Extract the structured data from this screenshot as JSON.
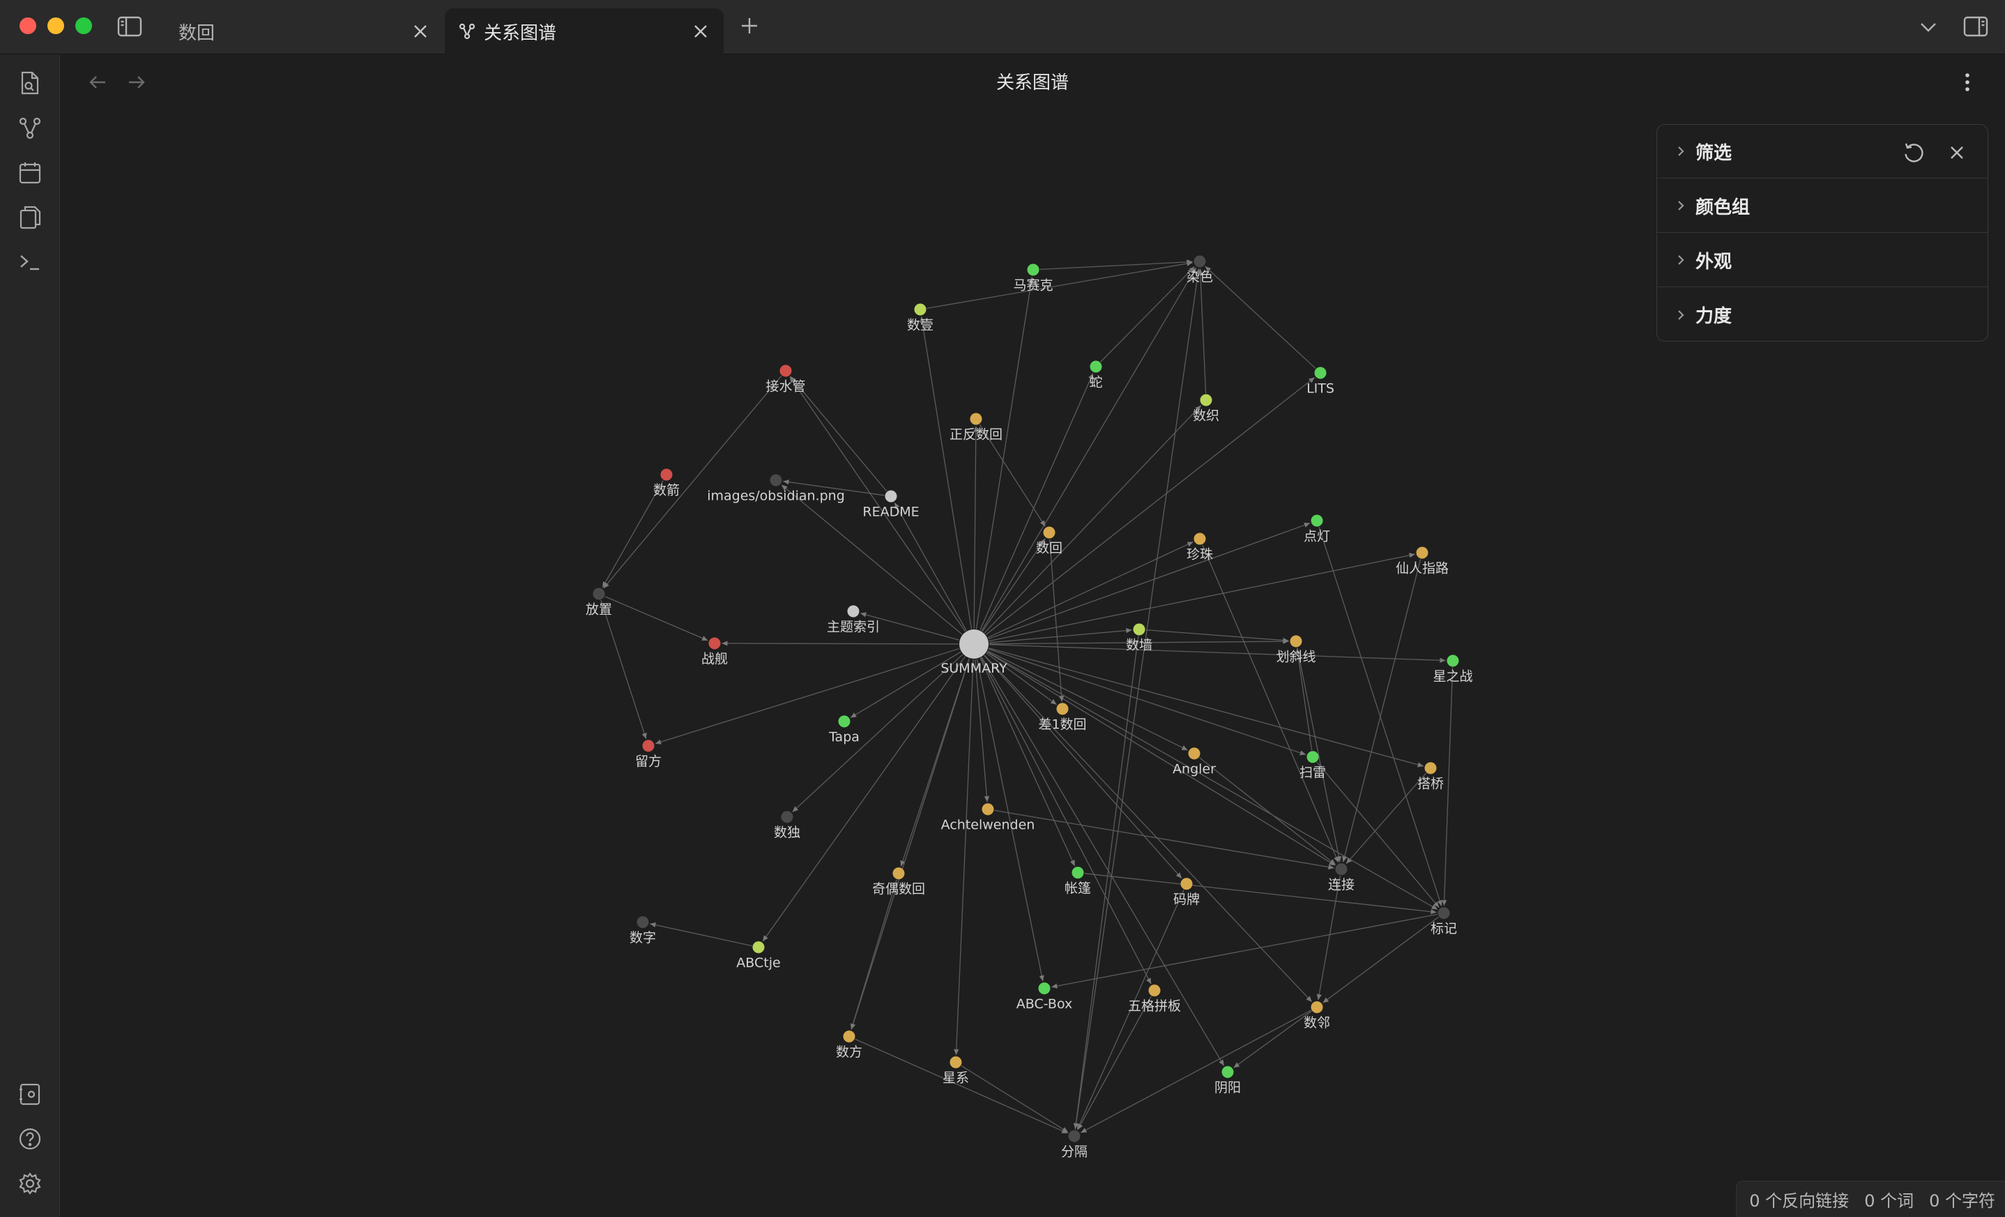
{
  "window": {
    "tabs": [
      {
        "label": "数回",
        "active": false
      },
      {
        "label": "关系图谱",
        "active": true
      }
    ]
  },
  "view": {
    "title": "关系图谱"
  },
  "ribbon": {
    "icons": [
      "file-search-icon",
      "graph-icon",
      "calendar-icon",
      "copy-icon",
      "terminal-icon",
      "vault-icon",
      "help-icon",
      "settings-icon"
    ]
  },
  "graph_controls": {
    "sections": [
      {
        "label": "筛选"
      },
      {
        "label": "颜色组"
      },
      {
        "label": "外观"
      },
      {
        "label": "力度"
      }
    ]
  },
  "statusbar": {
    "backlinks": "0 个反向链接",
    "words": "0 个词",
    "chars": "0 个字符"
  },
  "colors": {
    "green": "#5ad35a",
    "lime": "#b8d65a",
    "orange": "#d7a94e",
    "red": "#d0504a",
    "gray": "#4a4a4a",
    "white": "#c8c8c8",
    "edge": "#5c5c5c"
  },
  "graph": {
    "nodes": [
      {
        "id": "SUMMARY",
        "label": "SUMMARY",
        "color": "white",
        "hub": true
      },
      {
        "id": "染色",
        "label": "染色",
        "color": "gray"
      },
      {
        "id": "马赛克",
        "label": "马赛克",
        "color": "green"
      },
      {
        "id": "数壹",
        "label": "数壹",
        "color": "lime"
      },
      {
        "id": "蛇",
        "label": "蛇",
        "color": "green"
      },
      {
        "id": "LITS",
        "label": "LITS",
        "color": "green"
      },
      {
        "id": "数织",
        "label": "数织",
        "color": "lime"
      },
      {
        "id": "接水管",
        "label": "接水管",
        "color": "red"
      },
      {
        "id": "正反数回",
        "label": "正反数回",
        "color": "orange"
      },
      {
        "id": "数箭",
        "label": "数箭",
        "color": "red"
      },
      {
        "id": "images",
        "label": "images/obsidian.png",
        "color": "gray"
      },
      {
        "id": "README",
        "label": "README",
        "color": "white"
      },
      {
        "id": "数回",
        "label": "数回",
        "color": "orange"
      },
      {
        "id": "珍珠",
        "label": "珍珠",
        "color": "orange"
      },
      {
        "id": "点灯",
        "label": "点灯",
        "color": "green"
      },
      {
        "id": "仙人指路",
        "label": "仙人指路",
        "color": "orange"
      },
      {
        "id": "放置",
        "label": "放置",
        "color": "gray"
      },
      {
        "id": "主题索引",
        "label": "主题索引",
        "color": "white"
      },
      {
        "id": "战舰",
        "label": "战舰",
        "color": "red"
      },
      {
        "id": "数墙",
        "label": "数墙",
        "color": "lime"
      },
      {
        "id": "划斜线",
        "label": "划斜线",
        "color": "orange"
      },
      {
        "id": "星之战",
        "label": "星之战",
        "color": "green"
      },
      {
        "id": "差1数回",
        "label": "差1数回",
        "color": "orange"
      },
      {
        "id": "Tapa",
        "label": "Tapa",
        "color": "green"
      },
      {
        "id": "留方",
        "label": "留方",
        "color": "red"
      },
      {
        "id": "Angler",
        "label": "Angler",
        "color": "orange"
      },
      {
        "id": "扫雷",
        "label": "扫雷",
        "color": "green"
      },
      {
        "id": "搭桥",
        "label": "搭桥",
        "color": "orange"
      },
      {
        "id": "数独",
        "label": "数独",
        "color": "gray"
      },
      {
        "id": "Achtelwenden",
        "label": "Achtelwenden",
        "color": "orange"
      },
      {
        "id": "奇偶数回",
        "label": "奇偶数回",
        "color": "orange"
      },
      {
        "id": "帐篷",
        "label": "帐篷",
        "color": "green"
      },
      {
        "id": "码牌",
        "label": "码牌",
        "color": "orange"
      },
      {
        "id": "连接",
        "label": "连接",
        "color": "gray"
      },
      {
        "id": "标记",
        "label": "标记",
        "color": "gray"
      },
      {
        "id": "数字",
        "label": "数字",
        "color": "gray"
      },
      {
        "id": "ABCtje",
        "label": "ABCtje",
        "color": "lime"
      },
      {
        "id": "ABC-Box",
        "label": "ABC-Box",
        "color": "green"
      },
      {
        "id": "五格拼板",
        "label": "五格拼板",
        "color": "orange"
      },
      {
        "id": "数邻",
        "label": "数邻",
        "color": "orange"
      },
      {
        "id": "数方",
        "label": "数方",
        "color": "orange"
      },
      {
        "id": "星系",
        "label": "星系",
        "color": "orange"
      },
      {
        "id": "阴阳",
        "label": "阴阳",
        "color": "green"
      },
      {
        "id": "分隔",
        "label": "分隔",
        "color": "gray"
      }
    ],
    "edges": [
      [
        "SUMMARY",
        "马赛克"
      ],
      [
        "SUMMARY",
        "数壹"
      ],
      [
        "SUMMARY",
        "蛇"
      ],
      [
        "SUMMARY",
        "LITS"
      ],
      [
        "SUMMARY",
        "数织"
      ],
      [
        "SUMMARY",
        "接水管"
      ],
      [
        "SUMMARY",
        "正反数回"
      ],
      [
        "SUMMARY",
        "images"
      ],
      [
        "SUMMARY",
        "README"
      ],
      [
        "SUMMARY",
        "数回"
      ],
      [
        "SUMMARY",
        "珍珠"
      ],
      [
        "SUMMARY",
        "点灯"
      ],
      [
        "SUMMARY",
        "仙人指路"
      ],
      [
        "SUMMARY",
        "主题索引"
      ],
      [
        "SUMMARY",
        "战舰"
      ],
      [
        "SUMMARY",
        "数墙"
      ],
      [
        "SUMMARY",
        "划斜线"
      ],
      [
        "SUMMARY",
        "星之战"
      ],
      [
        "SUMMARY",
        "差1数回"
      ],
      [
        "SUMMARY",
        "Tapa"
      ],
      [
        "SUMMARY",
        "留方"
      ],
      [
        "SUMMARY",
        "Angler"
      ],
      [
        "SUMMARY",
        "扫雷"
      ],
      [
        "SUMMARY",
        "搭桥"
      ],
      [
        "SUMMARY",
        "数独"
      ],
      [
        "SUMMARY",
        "Achtelwenden"
      ],
      [
        "SUMMARY",
        "奇偶数回"
      ],
      [
        "SUMMARY",
        "帐篷"
      ],
      [
        "SUMMARY",
        "码牌"
      ],
      [
        "SUMMARY",
        "ABCtje"
      ],
      [
        "SUMMARY",
        "ABC-Box"
      ],
      [
        "SUMMARY",
        "五格拼板"
      ],
      [
        "SUMMARY",
        "数邻"
      ],
      [
        "SUMMARY",
        "星系"
      ],
      [
        "SUMMARY",
        "阴阳"
      ],
      [
        "SUMMARY",
        "数方"
      ],
      [
        "SUMMARY",
        "连接"
      ],
      [
        "SUMMARY",
        "标记"
      ],
      [
        "SUMMARY",
        "染色"
      ],
      [
        "马赛克",
        "染色"
      ],
      [
        "数壹",
        "染色"
      ],
      [
        "蛇",
        "染色"
      ],
      [
        "LITS",
        "染色"
      ],
      [
        "数织",
        "染色"
      ],
      [
        "分隔",
        "染色"
      ],
      [
        "README",
        "images"
      ],
      [
        "README",
        "接水管"
      ],
      [
        "接水管",
        "放置"
      ],
      [
        "数箭",
        "放置"
      ],
      [
        "放置",
        "战舰"
      ],
      [
        "放置",
        "留方"
      ],
      [
        "数回",
        "差1数回"
      ],
      [
        "正反数回",
        "数回"
      ],
      [
        "珍珠",
        "连接"
      ],
      [
        "点灯",
        "标记"
      ],
      [
        "仙人指路",
        "连接"
      ],
      [
        "数墙",
        "分隔"
      ],
      [
        "划斜线",
        "连接"
      ],
      [
        "星之战",
        "标记"
      ],
      [
        "扫雷",
        "标记"
      ],
      [
        "Angler",
        "连接"
      ],
      [
        "搭桥",
        "连接"
      ],
      [
        "Achtelwenden",
        "连接"
      ],
      [
        "帐篷",
        "标记"
      ],
      [
        "码牌",
        "分隔"
      ],
      [
        "连接",
        "数邻"
      ],
      [
        "标记",
        "ABC-Box"
      ],
      [
        "数邻",
        "阴阳"
      ],
      [
        "数邻",
        "分隔"
      ],
      [
        "五格拼板",
        "分隔"
      ],
      [
        "星系",
        "分隔"
      ],
      [
        "数方",
        "分隔"
      ],
      [
        "奇偶数回",
        "数方"
      ],
      [
        "ABCtje",
        "数字"
      ],
      [
        "标记",
        "数邻"
      ],
      [
        "扫雷",
        "划斜线"
      ],
      [
        "数墙",
        "划斜线"
      ]
    ]
  }
}
